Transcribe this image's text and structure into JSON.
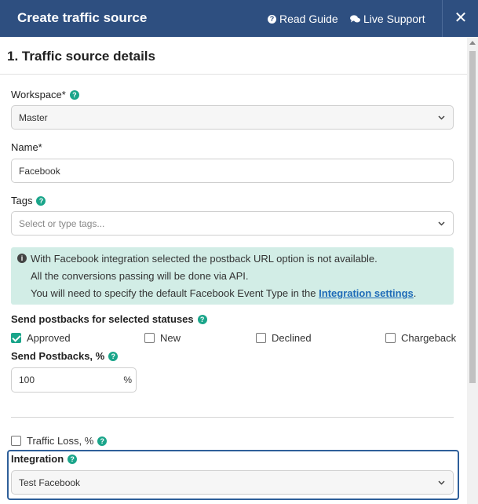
{
  "header": {
    "title": "Create traffic source",
    "read_guide": "Read Guide",
    "live_support": "Live Support",
    "close": "✕"
  },
  "section": {
    "title": "1. Traffic source details"
  },
  "workspace": {
    "label": "Workspace*",
    "value": "Master"
  },
  "name": {
    "label": "Name*",
    "value": "Facebook"
  },
  "tags": {
    "label": "Tags",
    "placeholder": "Select or type tags..."
  },
  "notice": {
    "line1": "With Facebook integration selected the postback URL option is not available.",
    "line2": "All the conversions passing will be done via API.",
    "line3_prefix": "You will need to specify the default Facebook Event Type in the ",
    "link": "Integration settings",
    "line3_suffix": "."
  },
  "postbacks": {
    "label": "Send postbacks for selected statuses",
    "statuses": [
      {
        "label": "Approved",
        "checked": true
      },
      {
        "label": "New",
        "checked": false
      },
      {
        "label": "Declined",
        "checked": false
      },
      {
        "label": "Chargeback",
        "checked": false
      }
    ]
  },
  "send_postbacks_pct": {
    "label": "Send Postbacks, %",
    "value": "100",
    "unit": "%"
  },
  "traffic_loss": {
    "label": "Traffic Loss, %",
    "checked": false
  },
  "integration": {
    "label": "Integration",
    "value": "Test Facebook"
  },
  "colors": {
    "header": "#2e4f80",
    "accent": "#1aa58a",
    "notice_bg": "#d2ede6",
    "link": "#1e6bb8"
  },
  "icons": {
    "help": "question-circle-icon",
    "info": "info-circle-icon",
    "chat": "chat-icon",
    "close": "close-icon",
    "dropdown": "chevron-down-icon"
  }
}
